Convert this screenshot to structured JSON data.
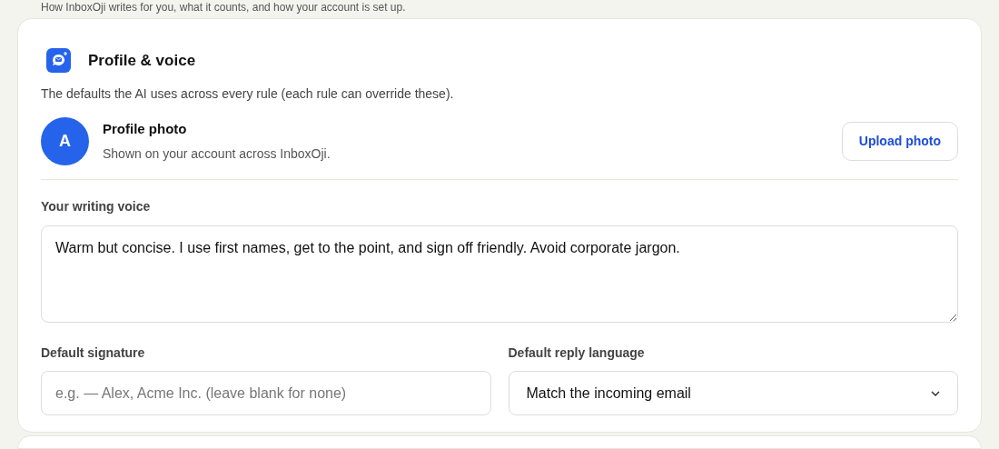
{
  "intro": "How InboxOji writes for you, what it counts, and how your account is set up.",
  "section": {
    "title": "Profile & voice",
    "description": "The defaults the AI uses across every rule (each rule can override these).",
    "profile": {
      "avatar_letter": "A",
      "title": "Profile photo",
      "subtitle": "Shown on your account across InboxOji.",
      "button": "Upload photo"
    },
    "voice": {
      "label": "Your writing voice",
      "value": "Warm but concise. I use first names, get to the point, and sign off friendly. Avoid corporate jargon."
    },
    "signature": {
      "label": "Default signature",
      "placeholder": "e.g. — Alex, Acme Inc. (leave blank for none)"
    },
    "language": {
      "label": "Default reply language",
      "value": "Match the incoming email"
    }
  }
}
